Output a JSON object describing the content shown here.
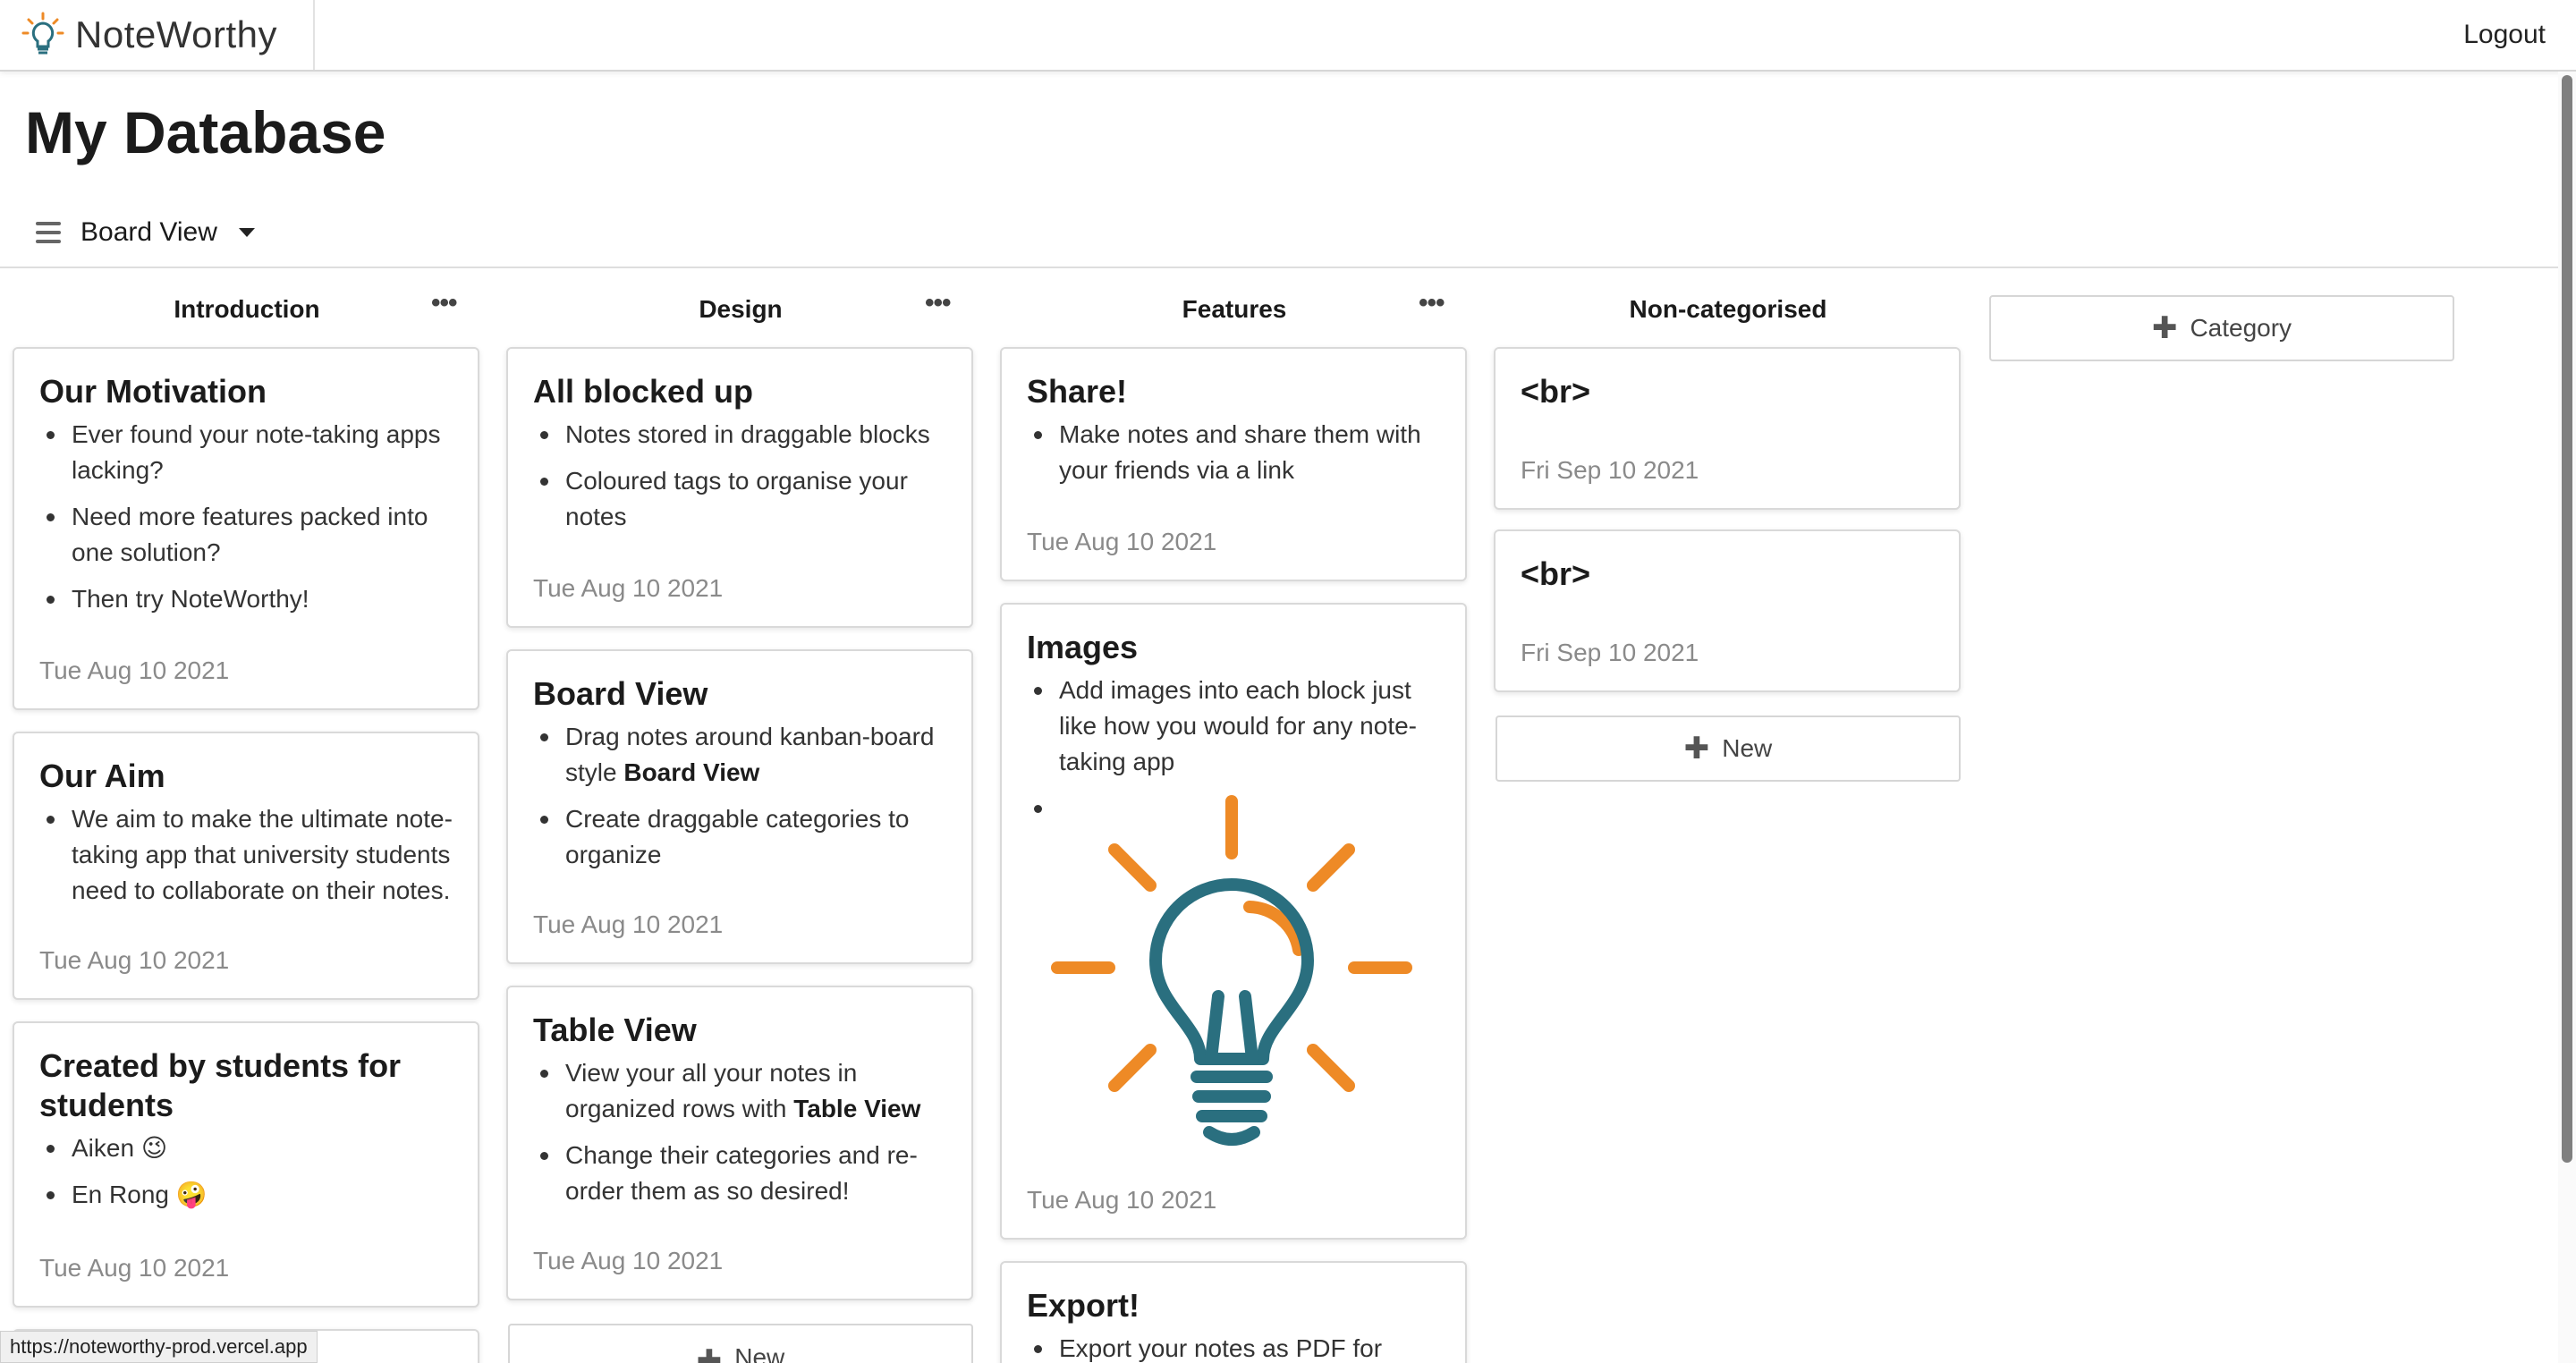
{
  "navbar": {
    "brand": "NoteWorthy",
    "logout": "Logout"
  },
  "page": {
    "title": "My Database",
    "view": "Board View"
  },
  "columns": [
    {
      "name": "Introduction",
      "menu": "•••"
    },
    {
      "name": "Design",
      "menu": "•••"
    },
    {
      "name": "Features",
      "menu": "•••"
    },
    {
      "name": "Non-categorised"
    }
  ],
  "add_category": "Category",
  "new_label": "New",
  "cards": {
    "motivation": {
      "title": "Our Motivation",
      "items": [
        "Ever found your note-taking apps lacking?",
        "Need more features packed into one solution?",
        "Then try NoteWorthy!"
      ],
      "date": "Tue Aug 10 2021"
    },
    "aim": {
      "title": "Our Aim",
      "items": [
        "We aim to make the ultimate note-taking app that university students need to collaborate on their notes."
      ],
      "date": "Tue Aug 10 2021"
    },
    "students": {
      "title": "Created by students for students",
      "items": [
        "Aiken 😉",
        "En Rong 🤪"
      ],
      "date": "Tue Aug 10 2021"
    },
    "blocked": {
      "title": "All blocked up",
      "items": [
        "Notes stored in draggable blocks",
        "Coloured tags to organise your notes"
      ],
      "date": "Tue Aug 10 2021"
    },
    "board": {
      "title": "Board View",
      "item1_pre": "Drag notes around kanban-board style ",
      "item1_bold": "Board View",
      "item2": "Create draggable categories to organize",
      "date": "Tue Aug 10 2021"
    },
    "table": {
      "title": "Table View",
      "item1_pre": "View your all your notes in organized rows with ",
      "item1_bold": "Table View",
      "item2": "Change their categories and re-order them as so desired!",
      "date": "Tue Aug 10 2021"
    },
    "share": {
      "title": "Share!",
      "items": [
        "Make notes and share them with your friends via a link"
      ],
      "date": "Tue Aug 10 2021"
    },
    "images": {
      "title": "Images",
      "items": [
        "Add images into each block just like how you would for any note-taking app"
      ],
      "image_icon": "lightbulb-illustration",
      "date": "Tue Aug 10 2021"
    },
    "export": {
      "title": "Export!",
      "items": [
        "Export your notes as PDF for"
      ]
    },
    "br1": {
      "title": "<br>",
      "date": "Fri Sep 10 2021"
    },
    "br2": {
      "title": "<br>",
      "date": "Fri Sep 10 2021"
    }
  },
  "status_url": "https://noteworthy-prod.vercel.app",
  "colors": {
    "accent_orange": "#ee8a26",
    "accent_teal": "#2a6f7f",
    "muted_text": "#8a8a8a"
  }
}
